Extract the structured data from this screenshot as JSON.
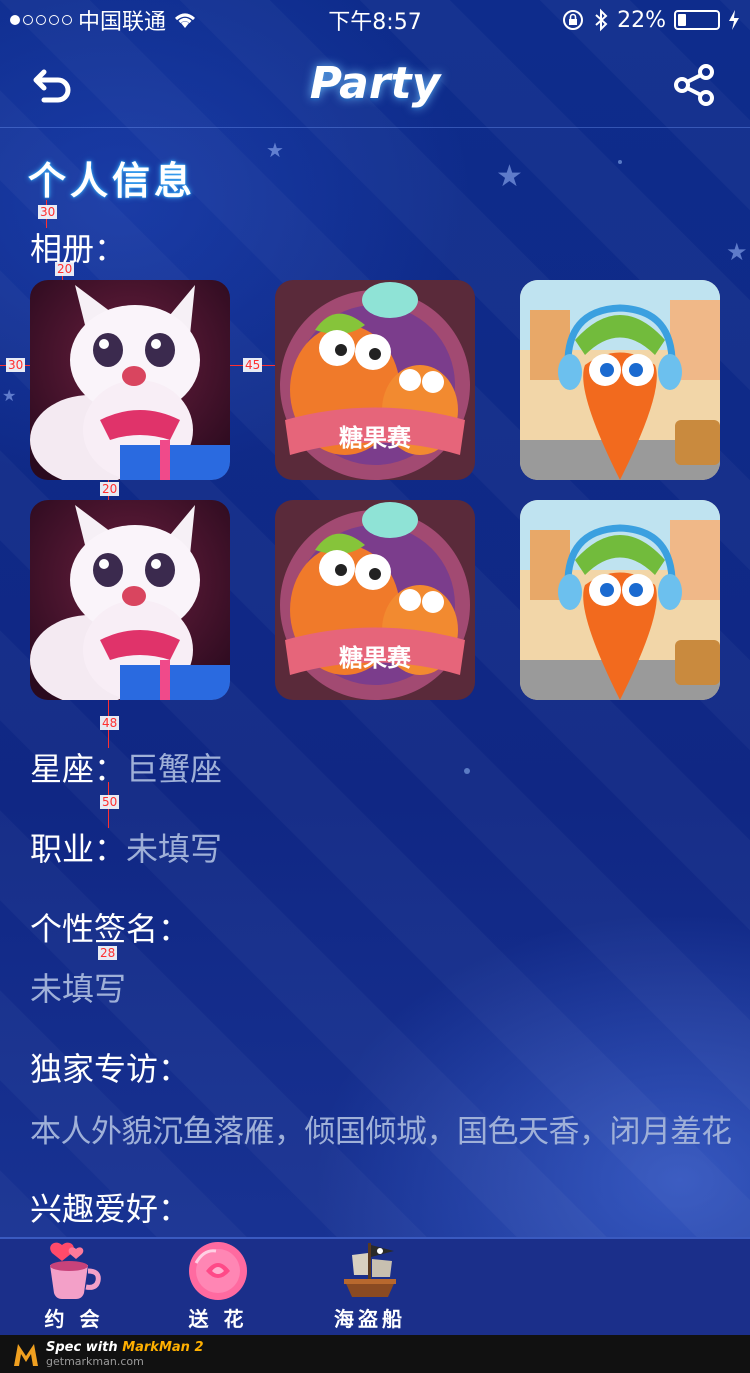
{
  "status_bar": {
    "carrier": "中国联通",
    "time": "下午8:57",
    "battery_percent_text": "22%",
    "battery_level": 0.22
  },
  "nav": {
    "title": "Party",
    "back_icon": "back-arrow-icon",
    "share_icon": "share-icon"
  },
  "profile": {
    "section_title": "个人信息",
    "album_label": "相册：",
    "photos": [
      {
        "name": "white-cat-with-gift"
      },
      {
        "name": "candy-carrots",
        "caption": "糖果赛"
      },
      {
        "name": "carrot-with-headphones"
      },
      {
        "name": "white-cat-with-gift"
      },
      {
        "name": "candy-carrots",
        "caption": "糖果赛"
      },
      {
        "name": "carrot-with-headphones"
      }
    ],
    "zodiac_label": "星座：",
    "zodiac_value": "巨蟹座",
    "job_label": "职业：",
    "job_value": "未填写",
    "signature_label": "个性签名：",
    "signature_value": "未填写",
    "interview_label": "独家专访：",
    "interview_value": "本人外貌沉鱼落雁，倾国倾城，国色天香，闭月羞花",
    "hobby_label": "兴趣爱好："
  },
  "measurements": {
    "m1": "30",
    "m2": "20",
    "m3": "30",
    "m4": "45",
    "m5": "20",
    "m6": "48",
    "m7": "50",
    "m8": "28"
  },
  "tabbar": {
    "items": [
      {
        "label": "约 会",
        "icon": "heart-cup-icon"
      },
      {
        "label": "送 花",
        "icon": "rose-icon"
      },
      {
        "label": "海盗船",
        "icon": "pirate-ship-icon"
      }
    ]
  },
  "footer": {
    "brand_prefix": "Spec with",
    "brand_name": "MarkMan 2",
    "url": "getmarkman.com"
  },
  "colors": {
    "background": "#0f2a88",
    "title_glow": "#1bb0ff",
    "value_text": "#9fb0d8",
    "measure": "#ff3030"
  }
}
